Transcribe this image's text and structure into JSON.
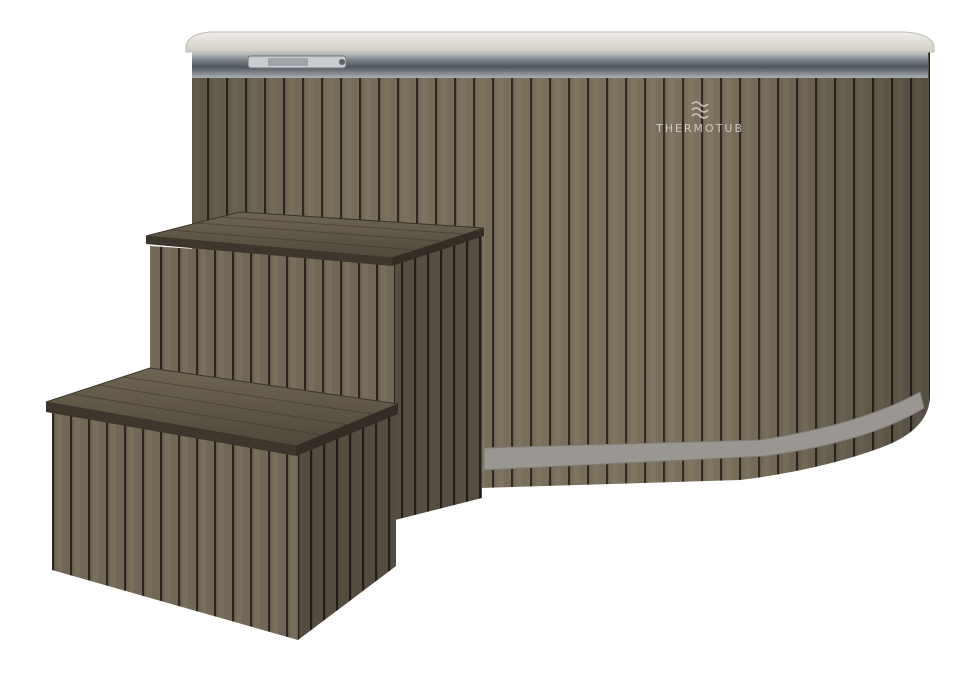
{
  "product": {
    "type": "wooden hot tub with steps",
    "logo_text": "THERMOTUB"
  },
  "colors": {
    "background": "#ffffff",
    "lid": "#e4e2dc",
    "lid_shadow": "#bdbab2",
    "steel_band": "#8f959a",
    "steel_band_light": "#cfd3d6",
    "wood_dark": "#4a4338",
    "wood_mid": "#6b6252",
    "wood_light": "#857a66",
    "wood_gap": "#2f2a23",
    "lower_band": "#9a9792"
  },
  "icons": {
    "logo": "wave-logo-icon",
    "latch": "latch-icon"
  }
}
